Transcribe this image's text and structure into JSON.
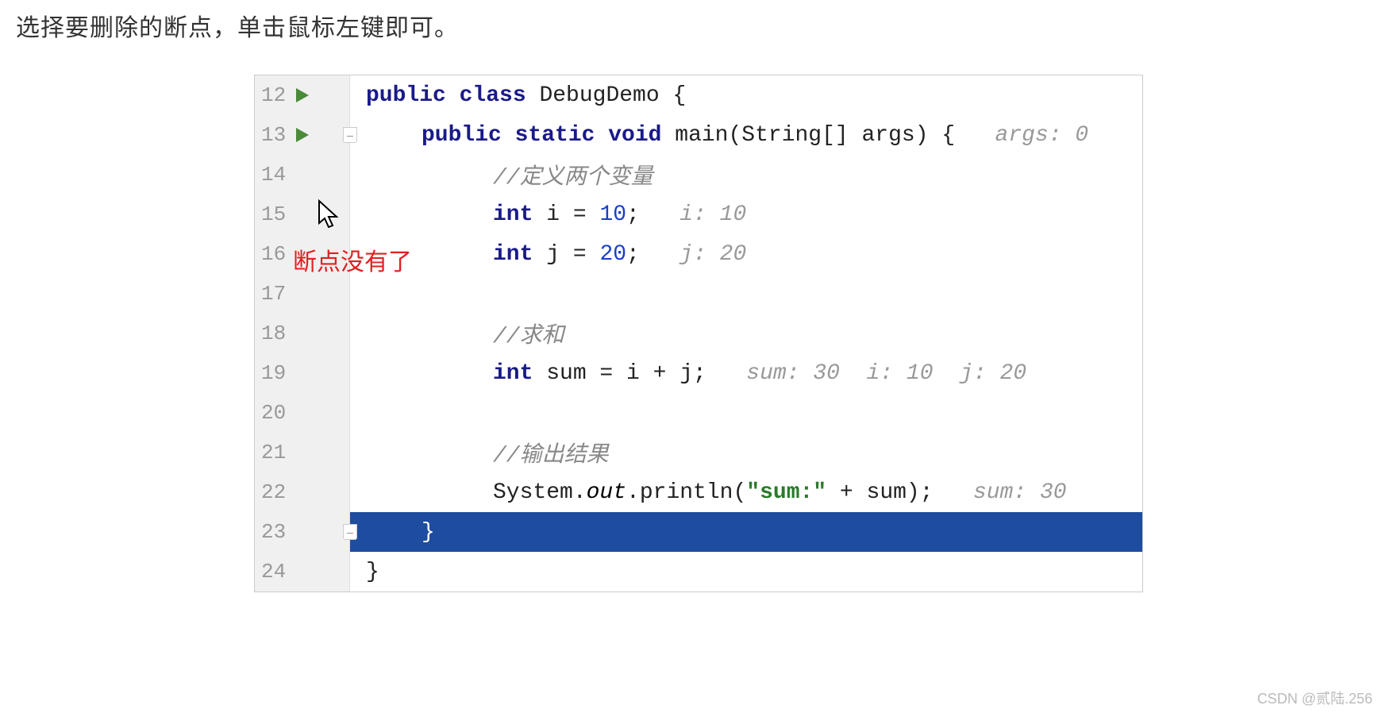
{
  "instruction": "选择要删除的断点，单击鼠标左键即可。",
  "annotation": "断点没有了",
  "watermark": "CSDN @贰陆.256",
  "lines": [
    {
      "num": "12",
      "hasRun": true,
      "hasFold": false,
      "indent": 1,
      "tokens": [
        {
          "cls": "kw",
          "text": "public class "
        },
        {
          "cls": "plain",
          "text": "DebugDemo {"
        }
      ]
    },
    {
      "num": "13",
      "hasRun": true,
      "hasFold": true,
      "indent": 2,
      "tokens": [
        {
          "cls": "kw",
          "text": "public static void "
        },
        {
          "cls": "plain",
          "text": "main(String[] args) {   "
        },
        {
          "cls": "inline-hint",
          "text": "args: 0"
        }
      ]
    },
    {
      "num": "14",
      "indent": 3,
      "tokens": [
        {
          "cls": "comment",
          "text": "//定义两个变量"
        }
      ]
    },
    {
      "num": "15",
      "cursorHere": true,
      "indent": 3,
      "tokens": [
        {
          "cls": "kw",
          "text": "int "
        },
        {
          "cls": "plain",
          "text": "i = "
        },
        {
          "cls": "num",
          "text": "10"
        },
        {
          "cls": "plain",
          "text": ";   "
        },
        {
          "cls": "inline-hint",
          "text": "i: 10"
        }
      ]
    },
    {
      "num": "16",
      "annotationHere": true,
      "indent": 3,
      "tokens": [
        {
          "cls": "kw",
          "text": "int "
        },
        {
          "cls": "plain",
          "text": "j = "
        },
        {
          "cls": "num",
          "text": "20"
        },
        {
          "cls": "plain",
          "text": ";   "
        },
        {
          "cls": "inline-hint",
          "text": "j: 20"
        }
      ]
    },
    {
      "num": "17",
      "indent": 3,
      "tokens": []
    },
    {
      "num": "18",
      "indent": 3,
      "tokens": [
        {
          "cls": "comment",
          "text": "//求和"
        }
      ]
    },
    {
      "num": "19",
      "indent": 3,
      "tokens": [
        {
          "cls": "kw",
          "text": "int "
        },
        {
          "cls": "plain",
          "text": "sum = i + j;   "
        },
        {
          "cls": "inline-hint",
          "text": "sum: 30  i: 10  j: 20"
        }
      ]
    },
    {
      "num": "20",
      "indent": 3,
      "tokens": []
    },
    {
      "num": "21",
      "indent": 3,
      "tokens": [
        {
          "cls": "comment",
          "text": "//输出结果"
        }
      ]
    },
    {
      "num": "22",
      "indent": 3,
      "tokens": [
        {
          "cls": "plain",
          "text": "System."
        },
        {
          "cls": "static-ref",
          "text": "out"
        },
        {
          "cls": "plain",
          "text": ".println("
        },
        {
          "cls": "str",
          "text": "\"sum:\""
        },
        {
          "cls": "plain",
          "text": " + sum);   "
        },
        {
          "cls": "inline-hint",
          "text": "sum: 30"
        }
      ]
    },
    {
      "num": "23",
      "hasFold": true,
      "highlighted": true,
      "indent": 2,
      "tokens": [
        {
          "cls": "plain",
          "text": "}"
        }
      ]
    },
    {
      "num": "24",
      "indent": 1,
      "tokens": [
        {
          "cls": "plain",
          "text": "}"
        }
      ]
    }
  ]
}
